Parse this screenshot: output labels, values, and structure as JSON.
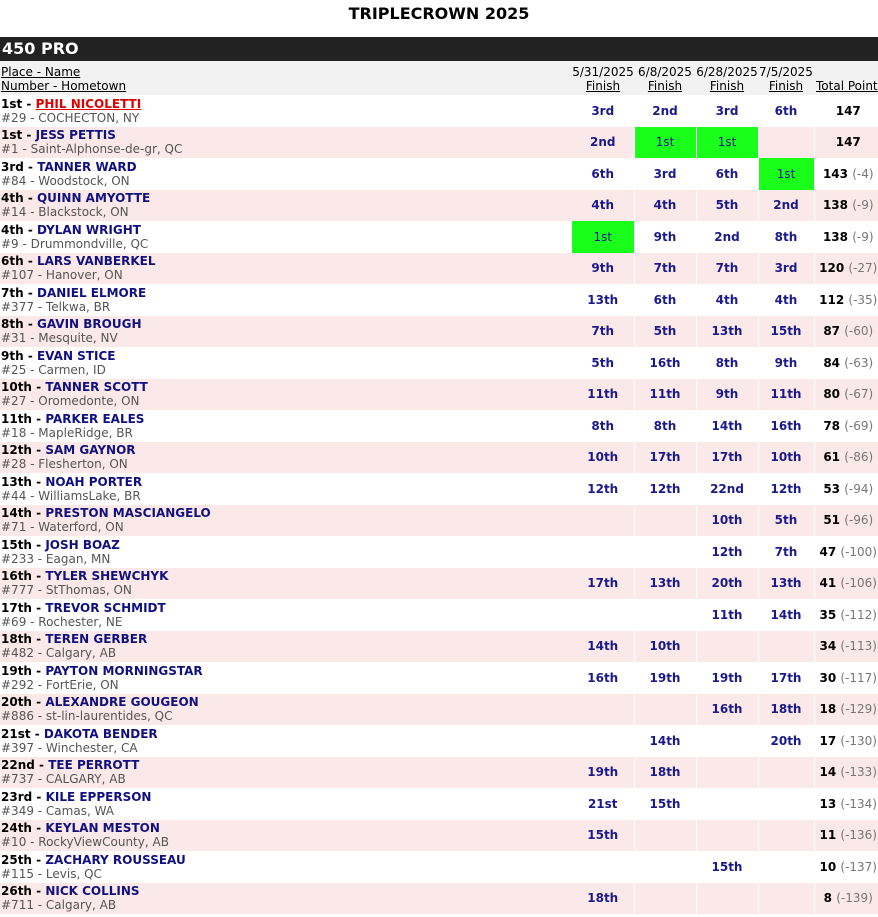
{
  "page": {
    "title": "TRIPLECROWN 2025"
  },
  "class_name": "450 PRO",
  "header": {
    "place_name": "Place - Name",
    "number_hometown": "Number - Hometown",
    "rounds": [
      {
        "date": "5/31/2025",
        "label": "Finish"
      },
      {
        "date": "6/8/2025",
        "label": "Finish"
      },
      {
        "date": "6/28/2025",
        "label": "Finish"
      },
      {
        "date": "7/5/2025",
        "label": "Finish"
      }
    ],
    "total": "Total Points"
  },
  "colors": {
    "win_highlight": "#1aff1a",
    "row_alt": "#fbe9e9",
    "rider_name": "#101080",
    "leader_name": "#e00000"
  },
  "riders": [
    {
      "place": "1st",
      "name": "PHIL NICOLETTI",
      "number_hometown": "#29 - COCHECTON, NY",
      "results": [
        "3rd",
        "2nd",
        "3rd",
        "6th"
      ],
      "points": "147",
      "behind": ""
    },
    {
      "place": "1st",
      "name": "JESS PETTIS",
      "number_hometown": "#1 - Saint-Alphonse-de-gr, QC",
      "results": [
        "2nd",
        "1st",
        "1st",
        ""
      ],
      "points": "147",
      "behind": ""
    },
    {
      "place": "3rd",
      "name": "TANNER WARD",
      "number_hometown": "#84 - Woodstock, ON",
      "results": [
        "6th",
        "3rd",
        "6th",
        "1st"
      ],
      "points": "143",
      "behind": "(-4)"
    },
    {
      "place": "4th",
      "name": "QUINN AMYOTTE",
      "number_hometown": "#14 - Blackstock, ON",
      "results": [
        "4th",
        "4th",
        "5th",
        "2nd"
      ],
      "points": "138",
      "behind": "(-9)"
    },
    {
      "place": "4th",
      "name": "DYLAN WRIGHT",
      "number_hometown": "#9 - Drummondville, QC",
      "results": [
        "1st",
        "9th",
        "2nd",
        "8th"
      ],
      "points": "138",
      "behind": "(-9)"
    },
    {
      "place": "6th",
      "name": "LARS VANBERKEL",
      "number_hometown": "#107 - Hanover, ON",
      "results": [
        "9th",
        "7th",
        "7th",
        "3rd"
      ],
      "points": "120",
      "behind": "(-27)"
    },
    {
      "place": "7th",
      "name": "DANIEL ELMORE",
      "number_hometown": "#377 - Telkwa, BR",
      "results": [
        "13th",
        "6th",
        "4th",
        "4th"
      ],
      "points": "112",
      "behind": "(-35)"
    },
    {
      "place": "8th",
      "name": "GAVIN BROUGH",
      "number_hometown": "#31 - Mesquite, NV",
      "results": [
        "7th",
        "5th",
        "13th",
        "15th"
      ],
      "points": "87",
      "behind": "(-60)"
    },
    {
      "place": "9th",
      "name": "EVAN STICE",
      "number_hometown": "#25 - Carmen, ID",
      "results": [
        "5th",
        "16th",
        "8th",
        "9th"
      ],
      "points": "84",
      "behind": "(-63)"
    },
    {
      "place": "10th",
      "name": "TANNER SCOTT",
      "number_hometown": "#27 - Oromedonte, ON",
      "results": [
        "11th",
        "11th",
        "9th",
        "11th"
      ],
      "points": "80",
      "behind": "(-67)"
    },
    {
      "place": "11th",
      "name": "PARKER EALES",
      "number_hometown": "#18 - MapleRidge, BR",
      "results": [
        "8th",
        "8th",
        "14th",
        "16th"
      ],
      "points": "78",
      "behind": "(-69)"
    },
    {
      "place": "12th",
      "name": "SAM GAYNOR",
      "number_hometown": "#28 - Flesherton, ON",
      "results": [
        "10th",
        "17th",
        "17th",
        "10th"
      ],
      "points": "61",
      "behind": "(-86)"
    },
    {
      "place": "13th",
      "name": "NOAH PORTER",
      "number_hometown": "#44 - WilliamsLake, BR",
      "results": [
        "12th",
        "12th",
        "22nd",
        "12th"
      ],
      "points": "53",
      "behind": "(-94)"
    },
    {
      "place": "14th",
      "name": "PRESTON MASCIANGELO",
      "number_hometown": "#71 - Waterford, ON",
      "results": [
        "",
        "",
        "10th",
        "5th"
      ],
      "points": "51",
      "behind": "(-96)"
    },
    {
      "place": "15th",
      "name": "JOSH BOAZ",
      "number_hometown": "#233 - Eagan, MN",
      "results": [
        "",
        "",
        "12th",
        "7th"
      ],
      "points": "47",
      "behind": "(-100)"
    },
    {
      "place": "16th",
      "name": "TYLER SHEWCHYK",
      "number_hometown": "#777 - StThomas, ON",
      "results": [
        "17th",
        "13th",
        "20th",
        "13th"
      ],
      "points": "41",
      "behind": "(-106)"
    },
    {
      "place": "17th",
      "name": "TREVOR SCHMIDT",
      "number_hometown": "#69 - Rochester, NE",
      "results": [
        "",
        "",
        "11th",
        "14th"
      ],
      "points": "35",
      "behind": "(-112)"
    },
    {
      "place": "18th",
      "name": "TEREN GERBER",
      "number_hometown": "#482 - Calgary, AB",
      "results": [
        "14th",
        "10th",
        "",
        ""
      ],
      "points": "34",
      "behind": "(-113)"
    },
    {
      "place": "19th",
      "name": "PAYTON MORNINGSTAR",
      "number_hometown": "#292 - FortErie, ON",
      "results": [
        "16th",
        "19th",
        "19th",
        "17th"
      ],
      "points": "30",
      "behind": "(-117)"
    },
    {
      "place": "20th",
      "name": "ALEXANDRE GOUGEON",
      "number_hometown": "#886 - st-lin-laurentides, QC",
      "results": [
        "",
        "",
        "16th",
        "18th"
      ],
      "points": "18",
      "behind": "(-129)"
    },
    {
      "place": "21st",
      "name": "DAKOTA BENDER",
      "number_hometown": "#397 - Winchester, CA",
      "results": [
        "",
        "14th",
        "",
        "20th"
      ],
      "points": "17",
      "behind": "(-130)"
    },
    {
      "place": "22nd",
      "name": "TEE PERROTT",
      "number_hometown": "#737 - CALGARY, AB",
      "results": [
        "19th",
        "18th",
        "",
        ""
      ],
      "points": "14",
      "behind": "(-133)"
    },
    {
      "place": "23rd",
      "name": "KILE EPPERSON",
      "number_hometown": "#349 - Camas, WA",
      "results": [
        "21st",
        "15th",
        "",
        ""
      ],
      "points": "13",
      "behind": "(-134)"
    },
    {
      "place": "24th",
      "name": "KEYLAN MESTON",
      "number_hometown": "#10 - RockyViewCounty, AB",
      "results": [
        "15th",
        "",
        "",
        ""
      ],
      "points": "11",
      "behind": "(-136)"
    },
    {
      "place": "25th",
      "name": "ZACHARY ROUSSEAU",
      "number_hometown": "#115 - Levis, QC",
      "results": [
        "",
        "",
        "15th",
        ""
      ],
      "points": "10",
      "behind": "(-137)"
    },
    {
      "place": "26th",
      "name": "NICK COLLINS",
      "number_hometown": "#711 - Calgary, AB",
      "results": [
        "18th",
        "",
        "",
        ""
      ],
      "points": "8",
      "behind": "(-139)"
    }
  ]
}
